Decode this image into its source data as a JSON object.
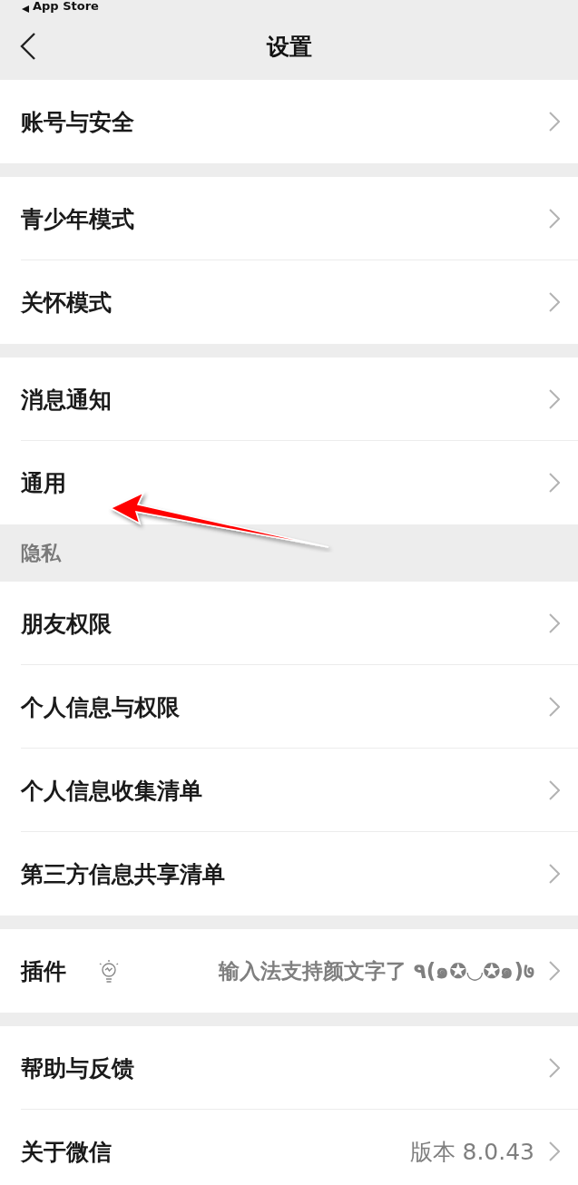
{
  "status_bar": {
    "back_app": "App Store"
  },
  "nav": {
    "title": "设置"
  },
  "groups": [
    {
      "items": [
        {
          "kind": "link",
          "label": "账号与安全"
        }
      ]
    },
    {
      "items": [
        {
          "kind": "link",
          "label": "青少年模式"
        },
        {
          "kind": "link",
          "label": "关怀模式"
        }
      ]
    },
    {
      "items": [
        {
          "kind": "link",
          "label": "消息通知"
        },
        {
          "kind": "link",
          "label": "通用"
        }
      ]
    },
    {
      "header": "隐私",
      "items": [
        {
          "kind": "link",
          "label": "朋友权限"
        },
        {
          "kind": "link",
          "label": "个人信息与权限"
        },
        {
          "kind": "link",
          "label": "个人信息收集清单"
        },
        {
          "kind": "link",
          "label": "第三方信息共享清单"
        }
      ]
    },
    {
      "items": [
        {
          "kind": "hint",
          "label": "插件",
          "value": "输入法支持颜文字了 ٩(๑✪◡✪๑)७"
        }
      ]
    },
    {
      "items": [
        {
          "kind": "link",
          "label": "帮助与反馈"
        },
        {
          "kind": "value",
          "label": "关于微信",
          "value": "版本 8.0.43"
        }
      ]
    }
  ]
}
